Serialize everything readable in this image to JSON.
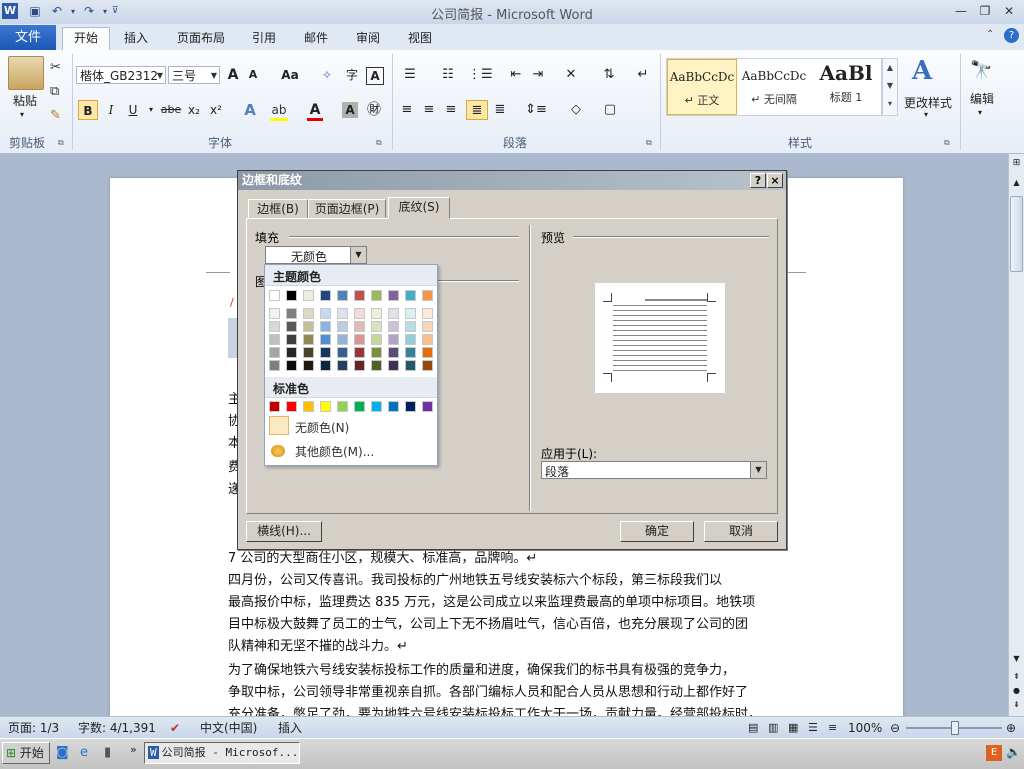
{
  "window": {
    "title": "公司简报 - Microsoft Word",
    "app_icon": "W"
  },
  "ribbon": {
    "file_tab": "文件",
    "tabs": [
      "开始",
      "插入",
      "页面布局",
      "引用",
      "邮件",
      "审阅",
      "视图"
    ],
    "clipboard": {
      "paste": "粘贴",
      "group": "剪贴板"
    },
    "font": {
      "name": "楷体_GB2312",
      "size": "三号",
      "group": "字体",
      "bold": "B",
      "italic": "I",
      "underline": "U",
      "strike": "abe",
      "sub": "x₂",
      "sup": "x²",
      "grow": "A",
      "shrink": "A",
      "case": "Aa",
      "char_border": "A",
      "font_color": "A",
      "shade": "A"
    },
    "paragraph": {
      "group": "段落"
    },
    "styles": {
      "group": "样式",
      "items": [
        {
          "sample": "AaBbCcDc",
          "name": "↵ 正文"
        },
        {
          "sample": "AaBbCcDc",
          "name": "↵ 无间隔"
        },
        {
          "sample": "AaBl",
          "name": "标题 1"
        }
      ],
      "change": "更改样式"
    },
    "editing": {
      "label": "编辑"
    }
  },
  "dialog": {
    "title": "边框和底纹",
    "help": "?",
    "close": "×",
    "tabs": [
      "边框(B)",
      "页面边框(P)",
      "底纹(S)"
    ],
    "fill_label": "填充",
    "fill_value": "无颜色",
    "pattern_label": "图",
    "preview_label": "预览",
    "apply_label": "应用于(L):",
    "apply_value": "段落",
    "lines_button": "横线(H)...",
    "ok": "确定",
    "cancel": "取消"
  },
  "color_popup": {
    "theme_title": "主题颜色",
    "standard_title": "标准色",
    "no_color": "无颜色(N)",
    "more_colors": "其他颜色(M)...",
    "theme_top": [
      "#ffffff",
      "#000000",
      "#eeece1",
      "#1f497d",
      "#4f81bd",
      "#c0504d",
      "#9bbb59",
      "#8064a2",
      "#4bacc6",
      "#f79646"
    ],
    "theme_shades": [
      [
        "#f2f2f2",
        "#7f7f7f",
        "#ddd9c3",
        "#c6d9f0",
        "#dbe5f1",
        "#f2dcdb",
        "#ebf1dd",
        "#e5e0ec",
        "#dbeef3",
        "#fdeada"
      ],
      [
        "#d8d8d8",
        "#595959",
        "#c4bd97",
        "#8db3e2",
        "#b8cce4",
        "#e5b9b7",
        "#d7e3bc",
        "#ccc1d9",
        "#b7dde8",
        "#fbd5b5"
      ],
      [
        "#bfbfbf",
        "#3f3f3f",
        "#938953",
        "#548dd4",
        "#95b3d7",
        "#d99694",
        "#c3d69b",
        "#b2a2c7",
        "#92cddc",
        "#fac08f"
      ],
      [
        "#a5a5a5",
        "#262626",
        "#494429",
        "#17365d",
        "#366092",
        "#953734",
        "#76923c",
        "#5f497a",
        "#31859b",
        "#e36c09"
      ],
      [
        "#7f7f7f",
        "#0c0c0c",
        "#1d1b10",
        "#0f243e",
        "#244061",
        "#632423",
        "#4f6128",
        "#3f3151",
        "#205867",
        "#974806"
      ]
    ],
    "standard": [
      "#c00000",
      "#ff0000",
      "#ffc000",
      "#ffff00",
      "#92d050",
      "#00b050",
      "#00b0f0",
      "#0070c0",
      "#002060",
      "#7030a0"
    ]
  },
  "document": {
    "partial_left": [
      "主",
      "协",
      "本",
      "费",
      "递"
    ],
    "lines": [
      "7    公司的大型商住小区，规模大、标准高，品牌响。↵",
      "    四月份，公司又传喜讯。我司投标的广州地铁五号线安装标六个标段，第三标段我们以",
      "最高报价中标，监理费达 835 万元，这是公司成立以来监理费最高的单项中标项目。地铁项",
      "目中标极大鼓舞了员工的士气，公司上下无不扬眉吐气，信心百倍，也充分展现了公司的团",
      "队精神和无坚不摧的战斗力。↵",
      "    为了确保地铁六号线安装标投标工作的质量和进度，确保我们的标书具有极强的竞争力，",
      "争取中标，公司领导非常重视亲自抓。各部门编标人员和配合人员从思想和行动上都作好了",
      "充分准备，憋足了劲，要为地铁六号线安装标投标工作大干一场，贡献力量。经营部投标时，"
    ]
  },
  "statusbar": {
    "page": "页面: 1/3",
    "words": "字数: 4/1,391",
    "lang": "中文(中国)",
    "mode": "插入",
    "zoom": "100%"
  },
  "taskbar": {
    "start": "开始",
    "task": "公司简报 - Microsof..."
  }
}
